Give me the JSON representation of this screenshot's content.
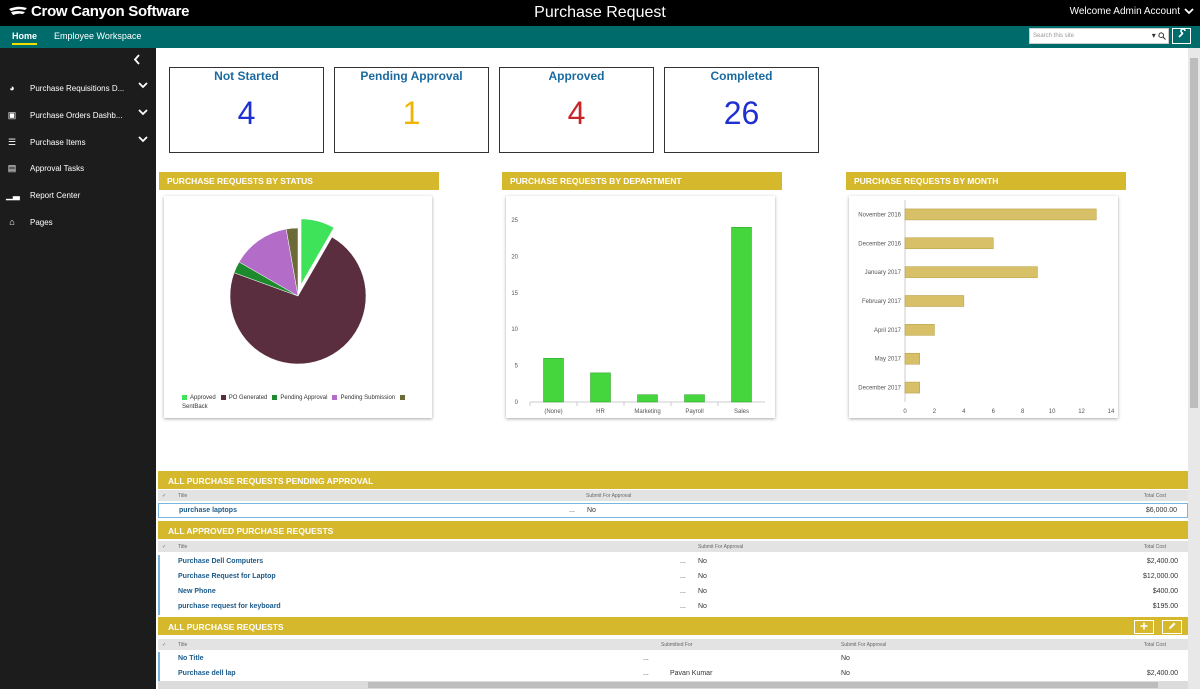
{
  "header": {
    "brand": "Crow Canyon Software",
    "title": "Purchase Request",
    "welcome": "Welcome Admin Account"
  },
  "nav": {
    "tabs": [
      "Home",
      "Employee Workspace"
    ],
    "search_placeholder": "Search this site"
  },
  "sidebar": {
    "items": [
      {
        "label": "Purchase Requisitions D...",
        "icon": "dashboard-icon",
        "expand": true
      },
      {
        "label": "Purchase Orders Dashb...",
        "icon": "document-icon",
        "expand": true
      },
      {
        "label": "Purchase Items",
        "icon": "list-icon",
        "expand": true
      },
      {
        "label": "Approval Tasks",
        "icon": "tasks-icon",
        "expand": false
      },
      {
        "label": "Report Center",
        "icon": "chart-icon",
        "expand": false
      },
      {
        "label": "Pages",
        "icon": "home-icon",
        "expand": false
      }
    ]
  },
  "kpis": [
    {
      "label": "Not Started",
      "value": "4",
      "color": "#1f2fd1"
    },
    {
      "label": "Pending Approval",
      "value": "1",
      "color": "#f0b400"
    },
    {
      "label": "Approved",
      "value": "4",
      "color": "#c8252a"
    },
    {
      "label": "Completed",
      "value": "26",
      "color": "#1f2fd1"
    }
  ],
  "chart_data": [
    {
      "type": "pie",
      "title": "PURCHASE REQUESTS BY STATUS",
      "series": [
        {
          "name": "Approved",
          "value": 3,
          "color": "#3fe35a"
        },
        {
          "name": "PO Generated",
          "value": 26,
          "color": "#5a2e3e"
        },
        {
          "name": "Pending Approval",
          "value": 1,
          "color": "#1e8a2e"
        },
        {
          "name": "Pending Submission",
          "value": 5,
          "color": "#b36cc8"
        },
        {
          "name": "SentBack",
          "value": 1,
          "color": "#6b6b3a"
        }
      ]
    },
    {
      "type": "bar",
      "title": "PURCHASE REQUESTS BY DEPARTMENT",
      "categories": [
        "(None)",
        "HR",
        "Marketing",
        "Payroll",
        "Sales"
      ],
      "values": [
        6,
        4,
        1,
        1,
        24
      ],
      "ylim": [
        0,
        25
      ],
      "yticks": [
        0,
        5,
        10,
        15,
        20,
        25
      ],
      "color": "#45d63e"
    },
    {
      "type": "bar",
      "orientation": "horizontal",
      "title": "PURCHASE REQUESTS BY MONTH",
      "categories": [
        "November 2016",
        "December 2016",
        "January 2017",
        "February 2017",
        "April 2017",
        "May 2017",
        "December 2017"
      ],
      "values": [
        13,
        6,
        9,
        4,
        2,
        1,
        1
      ],
      "xlim": [
        0,
        14
      ],
      "xticks": [
        0,
        2,
        4,
        6,
        8,
        10,
        12,
        14
      ],
      "color": "#d7c068"
    }
  ],
  "lists": {
    "pending": {
      "title": "ALL PURCHASE REQUESTS PENDING APPROVAL",
      "columns": [
        "Title",
        "Submit For Approval",
        "Total Cost"
      ],
      "rows": [
        {
          "title": "purchase laptops",
          "submit": "No",
          "cost": "$6,000.00"
        }
      ]
    },
    "approved": {
      "title": "ALL APPROVED PURCHASE REQUESTS",
      "columns": [
        "Title",
        "Submit For Approval",
        "Total Cost"
      ],
      "rows": [
        {
          "title": "Purchase Dell Computers",
          "submit": "No",
          "cost": "$2,400.00"
        },
        {
          "title": "Purchase Request for Laptop",
          "submit": "No",
          "cost": "$12,000.00"
        },
        {
          "title": "New Phone",
          "submit": "No",
          "cost": "$400.00"
        },
        {
          "title": "purchase request for keyboard",
          "submit": "No",
          "cost": "$195.00"
        }
      ]
    },
    "all": {
      "title": "ALL PURCHASE REQUESTS",
      "columns": [
        "Title",
        "Submitted For",
        "Submit For Approval",
        "Total Cost"
      ],
      "rows": [
        {
          "title": "No Title",
          "submitted_for": "",
          "submit": "No",
          "cost": ""
        },
        {
          "title": "Purchase dell lap",
          "submitted_for": "Pavan Kumar",
          "submit": "No",
          "cost": "$2,400.00"
        }
      ]
    }
  },
  "ellipsis": "..."
}
